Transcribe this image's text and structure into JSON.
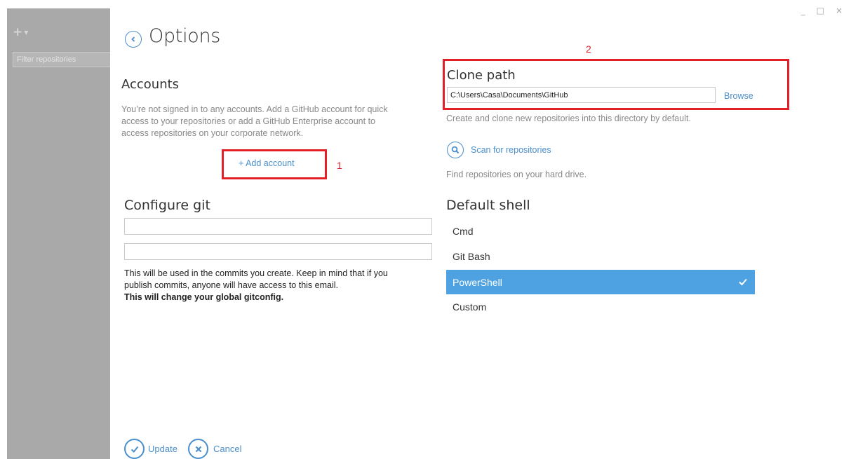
{
  "window": {
    "minimize": "_",
    "maximize": "□",
    "close": "×"
  },
  "sidebar": {
    "add_label": "+",
    "filter_placeholder": "Filter repositories"
  },
  "page": {
    "title": "Options"
  },
  "accounts": {
    "heading": "Accounts",
    "description_line1": "You’re not signed in to any accounts. Add a GitHub account for quick",
    "description_line2": "access to your repositories or add a GitHub Enterprise account to",
    "description_line3": "access repositories on your corporate network.",
    "add_label": "+ Add account"
  },
  "annotations": {
    "one": "1",
    "two": "2"
  },
  "configure_git": {
    "heading": "Configure git",
    "name_value": "",
    "email_value": "",
    "note_line1": "This will be used in the commits you create. Keep in mind that if you",
    "note_line2": "publish commits, anyone will have access to this email.",
    "note_bold": "This will change your global gitconfig."
  },
  "clone_path": {
    "heading": "Clone path",
    "value": "C:\\Users\\Casa\\Documents\\GitHub",
    "browse_label": "Browse",
    "description": "Create and clone new repositories into this directory by default."
  },
  "scan": {
    "label": "Scan for repositories",
    "description": "Find repositories on your hard drive."
  },
  "default_shell": {
    "heading": "Default shell",
    "options": [
      "Cmd",
      "Git Bash",
      "PowerShell",
      "Custom"
    ],
    "selected": "PowerShell"
  },
  "footer": {
    "update_label": "Update",
    "cancel_label": "Cancel"
  },
  "colors": {
    "accent": "#4a8fcd",
    "selected_bg": "#4fa2e1",
    "annotation": "#e3202a",
    "sidebar": "#a9a9a9"
  },
  "icons": {
    "back": "chevron-left-icon",
    "search": "search-icon",
    "check": "check-icon",
    "cancel": "x-icon"
  }
}
